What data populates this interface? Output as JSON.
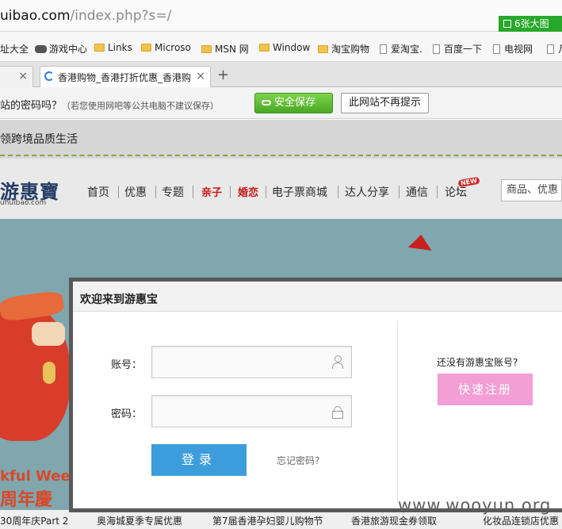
{
  "browser": {
    "address": {
      "url_host": "uibao.com",
      "url_path": "/index.php?s=/",
      "big_pic_label": "6张大图"
    },
    "bookmarks": [
      {
        "label": "址大全",
        "icon": "doc-icon"
      },
      {
        "label": "游戏中心",
        "icon": "gamepad-icon"
      },
      {
        "label": "Links",
        "icon": "folder-icon"
      },
      {
        "label": "Microso",
        "icon": "folder-icon"
      },
      {
        "label": "MSN 网",
        "icon": "folder-icon"
      },
      {
        "label": "Window",
        "icon": "folder-icon"
      },
      {
        "label": "淘宝购物",
        "icon": "folder-icon"
      },
      {
        "label": "爱淘宝.",
        "icon": "doc-icon"
      },
      {
        "label": "百度一下",
        "icon": "doc-icon"
      },
      {
        "label": "电视网",
        "icon": "doc-icon"
      },
      {
        "label": "凡",
        "icon": "doc-icon"
      }
    ],
    "tabs": [
      {
        "title": "",
        "close": "×"
      },
      {
        "title": "香港购物_香港打折优惠_香港购",
        "close": "×"
      }
    ],
    "new_tab": "+",
    "password_bar": {
      "question": "站的密码吗？",
      "hint": "（若您使用网吧等公共电脑不建议保存）",
      "save": "安全保存",
      "never": "此网站不再提示"
    }
  },
  "site": {
    "strip_text": "领跨境品质生活",
    "logo_cn": "游惠寶",
    "logo_url": "uhuibao.com",
    "nav": [
      "首页",
      "优惠",
      "专题",
      "亲子",
      "婚恋",
      "电子票商城",
      "达人分享",
      "通信",
      "论坛"
    ],
    "new_badge": "NEW",
    "search_placeholder": "商品、优惠",
    "promo_line1": "kful Week",
    "promo_line2": "周年慶",
    "bottom_links": [
      "30周年庆Part 2",
      "奥海城夏季专属优惠",
      "第7届香港孕妇婴儿购物节",
      "香港旅游现金券领取",
      "化妆品连锁店优惠"
    ],
    "watermark": "www.wooyun.org"
  },
  "login_modal": {
    "title": "欢迎来到游惠宝",
    "account_label": "账号：",
    "password_label": "密码：",
    "account_value": "",
    "password_value": "",
    "login_button": "登录",
    "forgot": "忘记密码?",
    "no_account": "还没有游惠宝账号?",
    "register_button": "快速注册"
  },
  "colors": {
    "login": "#3d9ddc",
    "register": "#f39ed4",
    "save_green": "#4aa824",
    "accent_red": "#c81b1b"
  }
}
